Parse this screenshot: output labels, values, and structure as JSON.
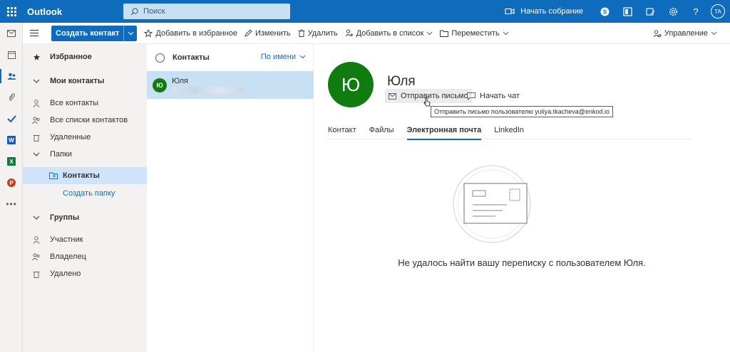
{
  "app": {
    "title": "Outlook"
  },
  "search": {
    "placeholder": "Поиск"
  },
  "top": {
    "meet_label": "Начать собрание",
    "avatar_initials": "TA"
  },
  "toolbar": {
    "new_label": "Создать контакт",
    "favorite_label": "Добавить в избранное",
    "edit_label": "Изменить",
    "delete_label": "Удалить",
    "add_to_list_label": "Добавить в список",
    "move_label": "Переместить",
    "manage_label": "Управление"
  },
  "nav": {
    "favorites": "Избранное",
    "my_contacts": "Мои контакты",
    "all_contacts": "Все контакты",
    "all_lists": "Все списки контактов",
    "deleted": "Удаленные",
    "folders": "Папки",
    "contacts_folder": "Контакты",
    "create_folder": "Создать папку",
    "groups": "Группы",
    "member": "Участник",
    "owner": "Владелец",
    "removed": "Удалено"
  },
  "list": {
    "header": "Контакты",
    "sort_label": "По имени",
    "items": [
      {
        "initial": "Ю",
        "name": "Юля"
      }
    ]
  },
  "contact": {
    "initial": "Ю",
    "name": "Юля",
    "send_mail_label": "Отправить письмо",
    "chat_label": "Начать чат",
    "tooltip": "Отправить письмо пользователю yuliya.tkacheva@enkod.io",
    "tabs": [
      "Контакт",
      "Файлы",
      "Электронная почта",
      "LinkedIn"
    ],
    "active_tab": "Электронная почта",
    "empty_message": "Не удалось найти вашу переписку с пользователем Юля."
  },
  "colors": {
    "brand": "#0f6cbd",
    "avatar": "#107c10",
    "selected": "#c7e0f4"
  }
}
